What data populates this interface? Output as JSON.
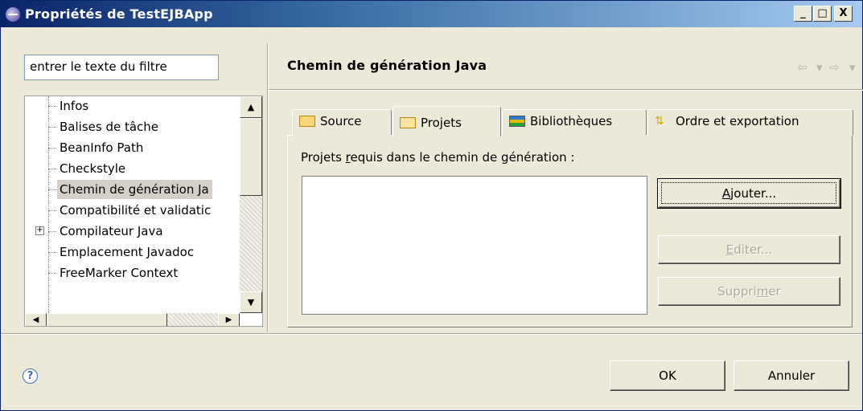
{
  "window": {
    "title": "Propriétés de TestEJBApp",
    "controls": {
      "minimize": "_",
      "maximize": "□",
      "close": "X"
    }
  },
  "filter": {
    "value": "entrer le texte du filtre"
  },
  "tree": {
    "items": [
      {
        "label": "Infos",
        "selected": false,
        "expandable": false
      },
      {
        "label": "Balises de tâche",
        "selected": false,
        "expandable": false
      },
      {
        "label": "BeanInfo Path",
        "selected": false,
        "expandable": false
      },
      {
        "label": "Checkstyle",
        "selected": false,
        "expandable": false
      },
      {
        "label": "Chemin de génération Ja",
        "selected": true,
        "expandable": false
      },
      {
        "label": "Compatibilité et validatic",
        "selected": false,
        "expandable": false
      },
      {
        "label": "Compilateur Java",
        "selected": false,
        "expandable": true
      },
      {
        "label": "Emplacement Javadoc",
        "selected": false,
        "expandable": false
      },
      {
        "label": "FreeMarker Context",
        "selected": false,
        "expandable": false
      }
    ],
    "expander_symbol": "+",
    "scroll": {
      "up": "▲",
      "down": "▼",
      "left": "◀",
      "right": "▶"
    }
  },
  "page": {
    "title": "Chemin de génération Java",
    "nav": {
      "back": "⇦",
      "back_menu": "▾",
      "forward": "⇨",
      "forward_menu": "▾"
    }
  },
  "tabs": [
    {
      "label": "Source",
      "icon": "source-folder-icon",
      "active": false
    },
    {
      "label": "Projets",
      "icon": "open-folder-icon",
      "active": true
    },
    {
      "label": "Bibliothèques",
      "icon": "libraries-icon",
      "active": false
    },
    {
      "label": "Ordre et exportation",
      "icon": "order-export-icon",
      "active": false
    }
  ],
  "projects": {
    "label_pre": "Projets ",
    "label_mnemonic": "r",
    "label_post": "equis dans le chemin de génération :",
    "items": []
  },
  "buttons": {
    "add": {
      "mnemonic": "A",
      "rest": "jouter..."
    },
    "edit": {
      "mnemonic": "E",
      "rest": "diter..."
    },
    "remove": {
      "pre": "Suppri",
      "mnemonic": "m",
      "post": "er"
    },
    "ok": "OK",
    "cancel": "Annuler",
    "help": "?"
  }
}
